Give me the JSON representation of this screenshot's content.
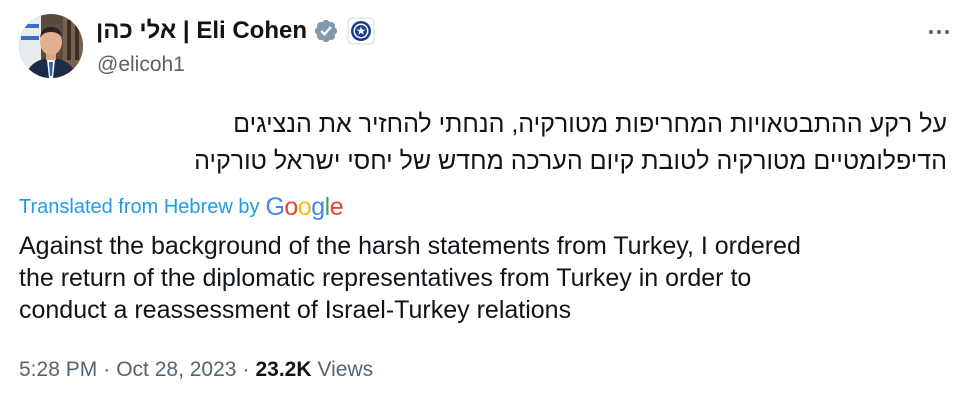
{
  "author": {
    "display_name": "אלי כהן | Eli Cohen",
    "handle": "@elicoh1",
    "verified_icon": "verified-badge-icon",
    "affiliation_icon": "government-affiliation-icon"
  },
  "tweet": {
    "hebrew_lines": [
      "על רקע ההתבטאויות המחריפות מטורקיה, הנחתי להחזיר את הנציגים",
      "הדיפלומטיים מטורקיה לטובת קיום הערכה מחדש של יחסי ישראל טורקיה"
    ],
    "translation_label": "Translated from Hebrew by",
    "translation_provider": "Google",
    "english_lines": [
      "Against the background of the harsh statements from Turkey, I ordered",
      "the return of the diplomatic representatives from Turkey in order to",
      "conduct a reassessment of Israel-Turkey relations"
    ]
  },
  "meta": {
    "time": "5:28 PM",
    "separator": "·",
    "date": "Oct 28, 2023",
    "views_count": "23.2K",
    "views_label": "Views"
  },
  "colors": {
    "text": "#0f1419",
    "secondary": "#536471",
    "link": "#1d9bf0",
    "verified": "#829aab",
    "google_blue": "#4285f4",
    "google_red": "#ea4335",
    "google_yellow": "#fbbc05",
    "google_green": "#34a853"
  }
}
